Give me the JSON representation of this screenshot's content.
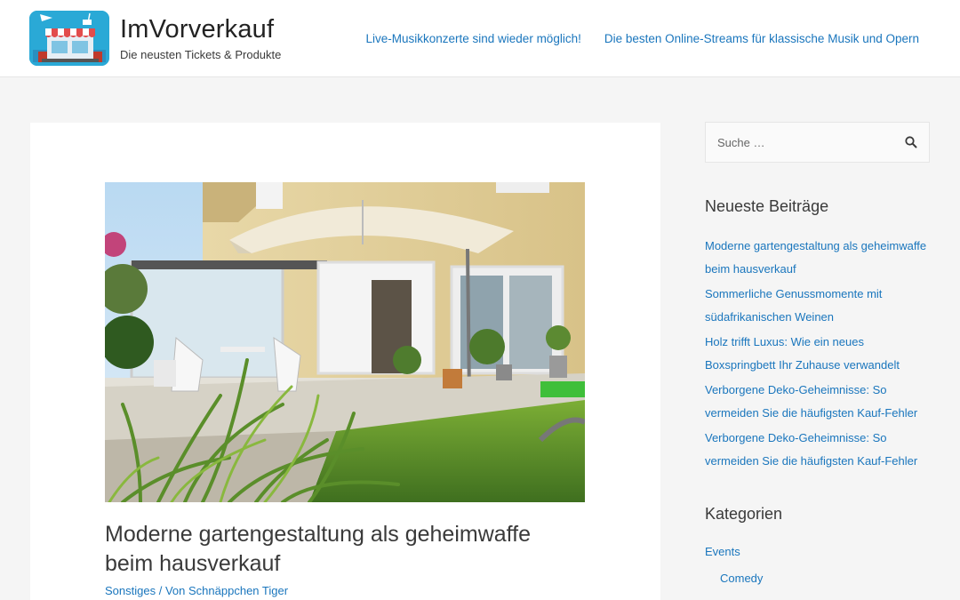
{
  "header": {
    "site_title": "ImVorverkauf",
    "site_description": "Die neusten Tickets & Produkte",
    "nav": [
      {
        "label": "Live-Musikkonzerte sind wieder möglich!"
      },
      {
        "label": "Die besten Online-Streams für klassische Musik und Opern"
      }
    ]
  },
  "post": {
    "title": "Moderne gartengestaltung als geheimwaffe beim hausverkauf",
    "category": "Sonstiges",
    "separator": "/",
    "author_prefix": "Von",
    "author": "Schnäppchen Tiger"
  },
  "sidebar": {
    "search": {
      "placeholder": "Suche …"
    },
    "recent_title": "Neueste Beiträge",
    "recent_posts": [
      {
        "label": "Moderne gartengestaltung als geheimwaffe beim hausverkauf"
      },
      {
        "label": "Sommerliche Genussmomente mit südafrikanischen Weinen"
      },
      {
        "label": "Holz trifft Luxus: Wie ein neues Boxspringbett Ihr Zuhause verwandelt"
      },
      {
        "label": "Verborgene Deko-Geheimnisse: So vermeiden Sie die häufigsten Kauf-Fehler"
      },
      {
        "label": "Verborgene Deko-Geheimnisse: So vermeiden Sie die häufigsten Kauf-Fehler"
      }
    ],
    "categories_title": "Kategorien",
    "categories": [
      {
        "label": "Events"
      },
      {
        "label": "Comedy"
      }
    ]
  },
  "colors": {
    "link": "#1a76bd",
    "background": "#f5f5f5",
    "logo_bg": "#2aa9d6"
  },
  "icons": {
    "search": "search-icon",
    "logo": "shop-storefront-logo"
  }
}
